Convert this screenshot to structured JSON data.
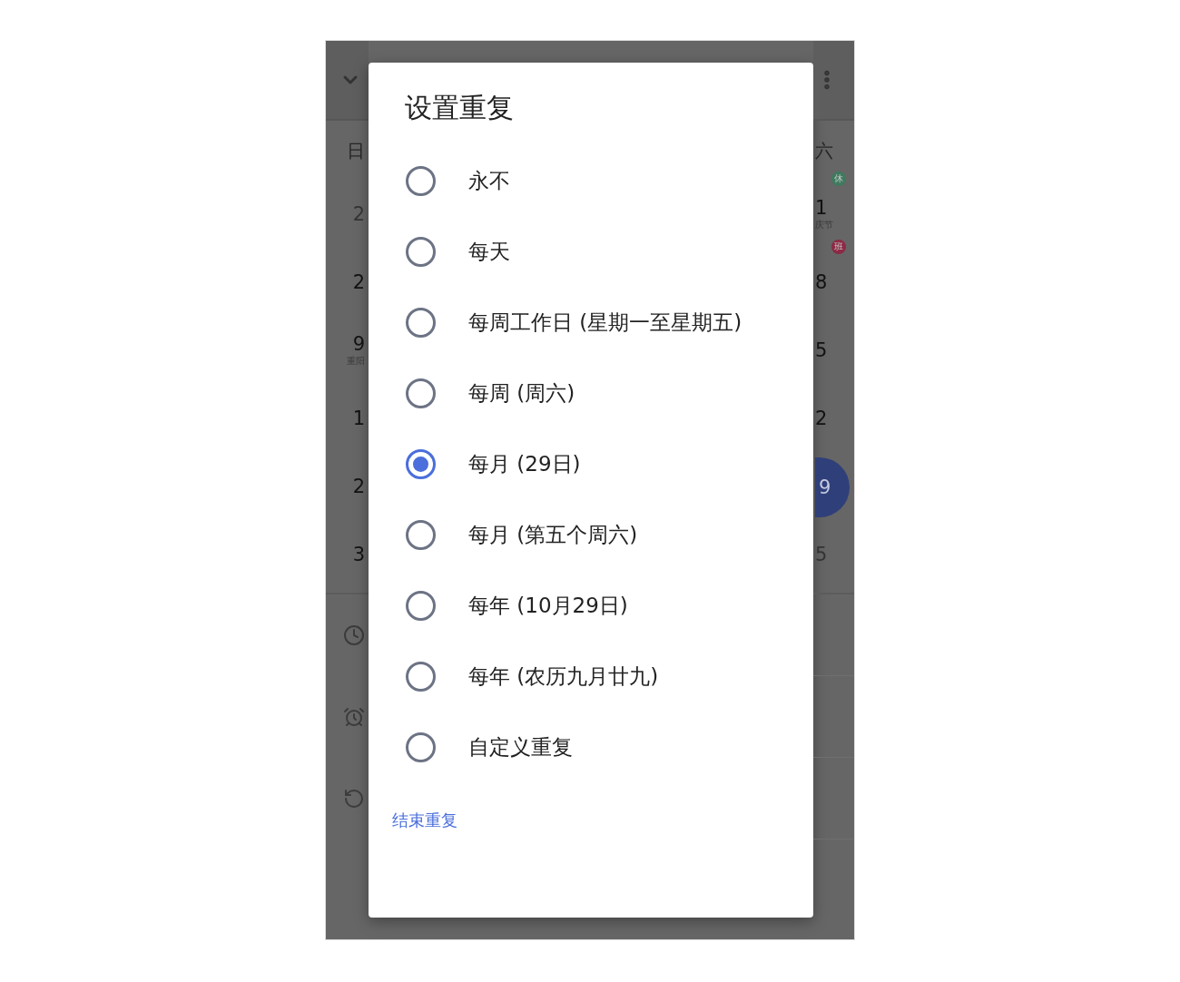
{
  "background": {
    "left_column": {
      "weekday": "日",
      "dates": [
        {
          "day": "2",
          "faint": true,
          "selected": false
        },
        {
          "day": "2",
          "faint": false,
          "selected": false
        },
        {
          "day": "9",
          "note": "重阳",
          "faint": false,
          "selected": false
        },
        {
          "day": "1",
          "faint": false,
          "selected": false
        },
        {
          "day": "2",
          "faint": false,
          "selected": false
        },
        {
          "day": "3",
          "faint": false,
          "selected": false
        }
      ]
    },
    "right_column": {
      "weekday": "六",
      "dates": [
        {
          "day": "1",
          "note": "庆节",
          "badge": {
            "text": "休",
            "color": "#3f7a5f"
          },
          "faint": false,
          "selected": false
        },
        {
          "day": "8",
          "badge": {
            "text": "班",
            "color": "#8c2a45"
          },
          "faint": false,
          "selected": false
        },
        {
          "day": "5",
          "faint": false,
          "selected": false
        },
        {
          "day": "2",
          "faint": false,
          "selected": false
        },
        {
          "day": "9",
          "faint": false,
          "selected": true
        },
        {
          "day": "5",
          "faint": true,
          "selected": false
        }
      ]
    }
  },
  "dialog": {
    "title": "设置重复",
    "options": [
      {
        "label": "永不",
        "selected": false
      },
      {
        "label": "每天",
        "selected": false
      },
      {
        "label": "每周工作日 (星期一至星期五)",
        "selected": false
      },
      {
        "label": "每周 (周六)",
        "selected": false
      },
      {
        "label": "每月 (29日)",
        "selected": true
      },
      {
        "label": "每月 (第五个周六)",
        "selected": false
      },
      {
        "label": "每年 (10月29日)",
        "selected": false
      },
      {
        "label": "每年 (农历九月廿九)",
        "selected": false
      },
      {
        "label": "自定义重复",
        "selected": false
      }
    ],
    "link": "结束重复"
  }
}
